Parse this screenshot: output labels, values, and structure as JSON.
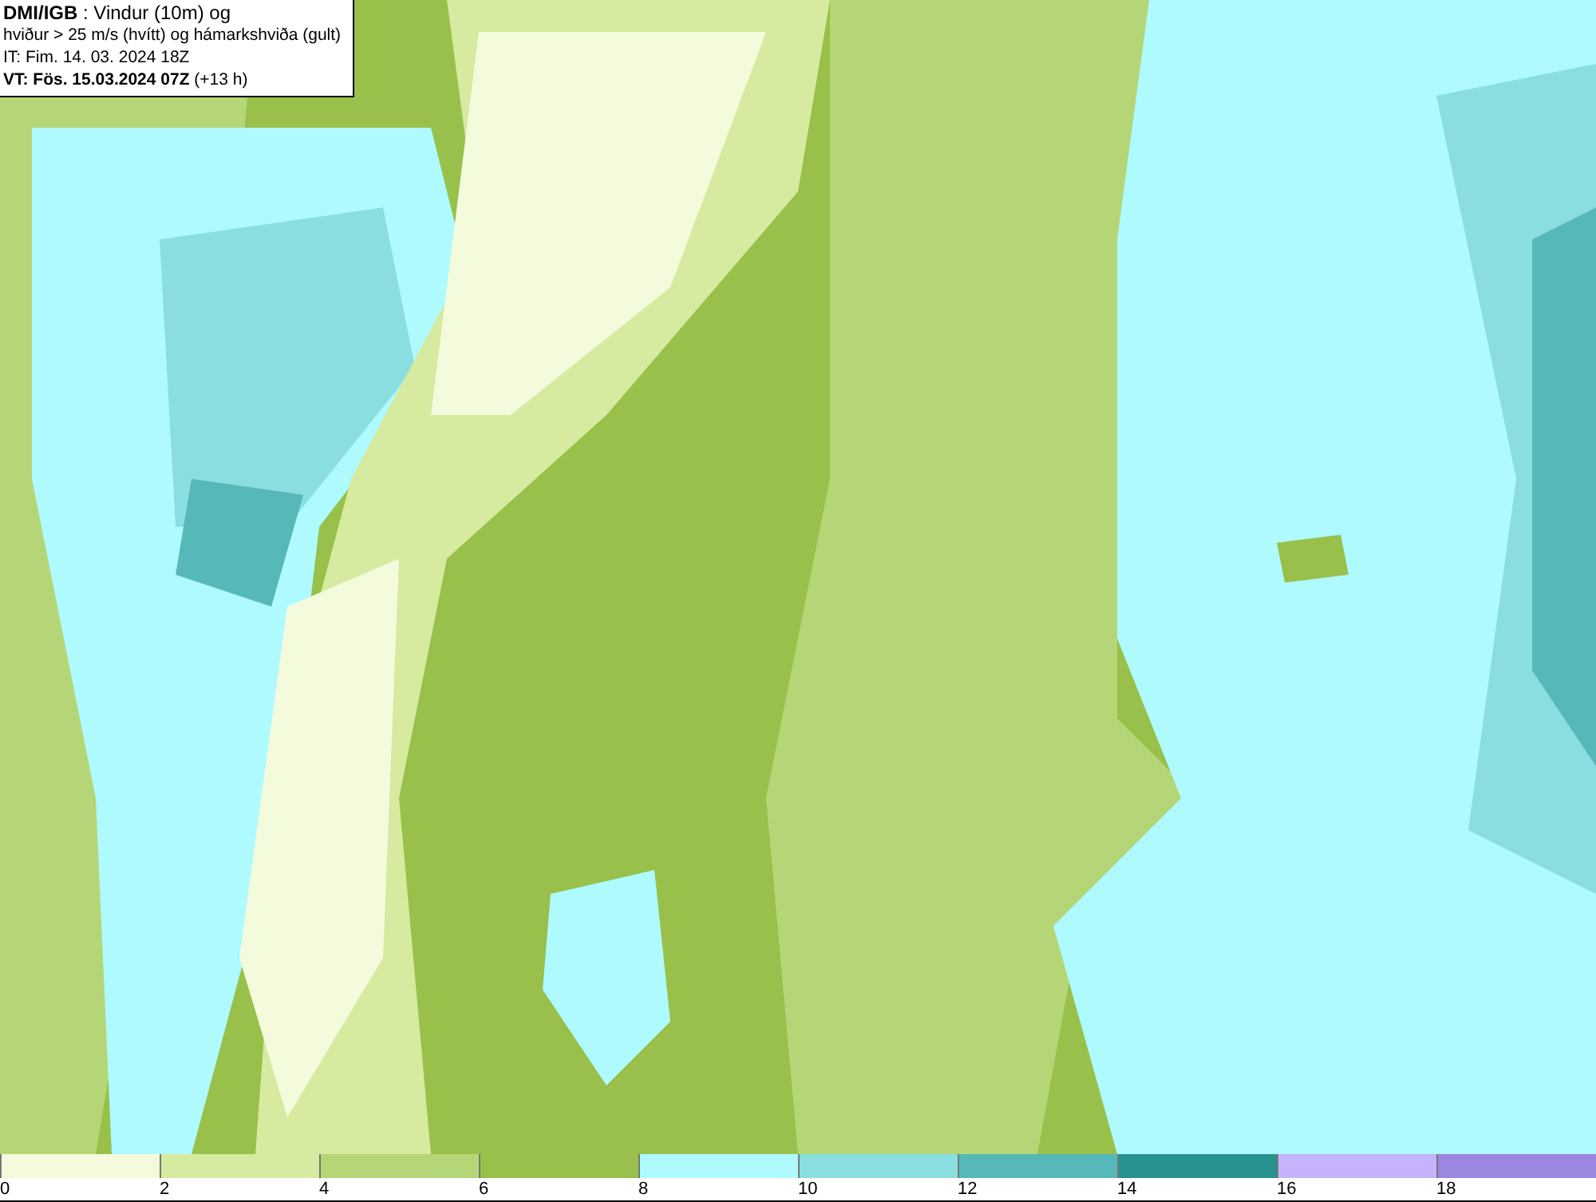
{
  "header": {
    "lines": [
      "**DMI/IGB** : Vindur (10m) og",
      "hviður > 25 m/s (hvítt) og hámarkshviða (gult)",
      "IT: Fim. 14. 03. 2024 18Z",
      "**VT: Fös. 15.03.2024 07Z** (+13 h)"
    ]
  },
  "legend": [
    {
      "label": "0",
      "color": "#f4fbdc"
    },
    {
      "label": "2",
      "color": "#d6eaa0"
    },
    {
      "label": "4",
      "color": "#b5d676"
    },
    {
      "label": "6",
      "color": "#98c04a"
    },
    {
      "label": "8",
      "color": "#aefaff"
    },
    {
      "label": "10",
      "color": "#8bdedf"
    },
    {
      "label": "12",
      "color": "#56b8b8"
    },
    {
      "label": "14",
      "color": "#269390"
    },
    {
      "label": "16",
      "color": "#c6b3fc"
    },
    {
      "label": "18",
      "color": "#9b87e0"
    }
  ]
}
